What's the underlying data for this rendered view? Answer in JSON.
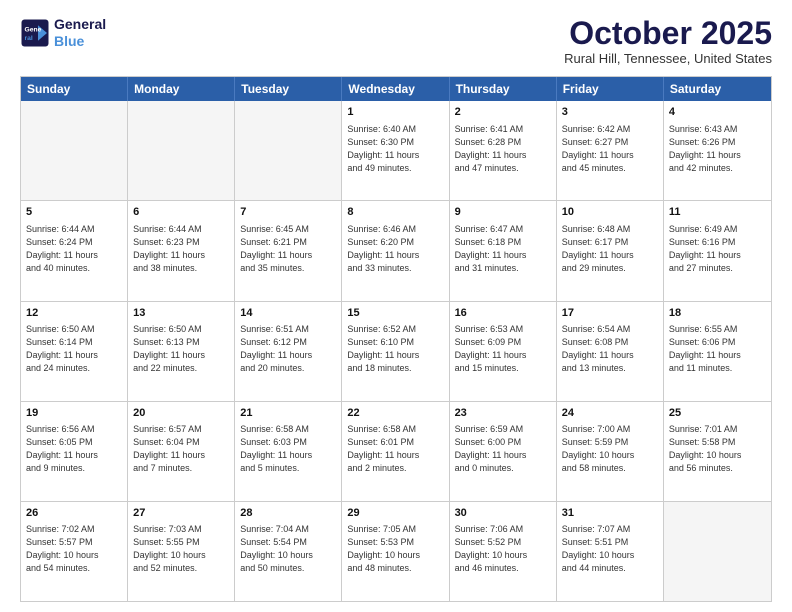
{
  "header": {
    "logo_line1": "General",
    "logo_line2": "Blue",
    "month_title": "October 2025",
    "location": "Rural Hill, Tennessee, United States"
  },
  "weekdays": [
    "Sunday",
    "Monday",
    "Tuesday",
    "Wednesday",
    "Thursday",
    "Friday",
    "Saturday"
  ],
  "rows": [
    [
      {
        "day": "",
        "text": ""
      },
      {
        "day": "",
        "text": ""
      },
      {
        "day": "",
        "text": ""
      },
      {
        "day": "1",
        "text": "Sunrise: 6:40 AM\nSunset: 6:30 PM\nDaylight: 11 hours\nand 49 minutes."
      },
      {
        "day": "2",
        "text": "Sunrise: 6:41 AM\nSunset: 6:28 PM\nDaylight: 11 hours\nand 47 minutes."
      },
      {
        "day": "3",
        "text": "Sunrise: 6:42 AM\nSunset: 6:27 PM\nDaylight: 11 hours\nand 45 minutes."
      },
      {
        "day": "4",
        "text": "Sunrise: 6:43 AM\nSunset: 6:26 PM\nDaylight: 11 hours\nand 42 minutes."
      }
    ],
    [
      {
        "day": "5",
        "text": "Sunrise: 6:44 AM\nSunset: 6:24 PM\nDaylight: 11 hours\nand 40 minutes."
      },
      {
        "day": "6",
        "text": "Sunrise: 6:44 AM\nSunset: 6:23 PM\nDaylight: 11 hours\nand 38 minutes."
      },
      {
        "day": "7",
        "text": "Sunrise: 6:45 AM\nSunset: 6:21 PM\nDaylight: 11 hours\nand 35 minutes."
      },
      {
        "day": "8",
        "text": "Sunrise: 6:46 AM\nSunset: 6:20 PM\nDaylight: 11 hours\nand 33 minutes."
      },
      {
        "day": "9",
        "text": "Sunrise: 6:47 AM\nSunset: 6:18 PM\nDaylight: 11 hours\nand 31 minutes."
      },
      {
        "day": "10",
        "text": "Sunrise: 6:48 AM\nSunset: 6:17 PM\nDaylight: 11 hours\nand 29 minutes."
      },
      {
        "day": "11",
        "text": "Sunrise: 6:49 AM\nSunset: 6:16 PM\nDaylight: 11 hours\nand 27 minutes."
      }
    ],
    [
      {
        "day": "12",
        "text": "Sunrise: 6:50 AM\nSunset: 6:14 PM\nDaylight: 11 hours\nand 24 minutes."
      },
      {
        "day": "13",
        "text": "Sunrise: 6:50 AM\nSunset: 6:13 PM\nDaylight: 11 hours\nand 22 minutes."
      },
      {
        "day": "14",
        "text": "Sunrise: 6:51 AM\nSunset: 6:12 PM\nDaylight: 11 hours\nand 20 minutes."
      },
      {
        "day": "15",
        "text": "Sunrise: 6:52 AM\nSunset: 6:10 PM\nDaylight: 11 hours\nand 18 minutes."
      },
      {
        "day": "16",
        "text": "Sunrise: 6:53 AM\nSunset: 6:09 PM\nDaylight: 11 hours\nand 15 minutes."
      },
      {
        "day": "17",
        "text": "Sunrise: 6:54 AM\nSunset: 6:08 PM\nDaylight: 11 hours\nand 13 minutes."
      },
      {
        "day": "18",
        "text": "Sunrise: 6:55 AM\nSunset: 6:06 PM\nDaylight: 11 hours\nand 11 minutes."
      }
    ],
    [
      {
        "day": "19",
        "text": "Sunrise: 6:56 AM\nSunset: 6:05 PM\nDaylight: 11 hours\nand 9 minutes."
      },
      {
        "day": "20",
        "text": "Sunrise: 6:57 AM\nSunset: 6:04 PM\nDaylight: 11 hours\nand 7 minutes."
      },
      {
        "day": "21",
        "text": "Sunrise: 6:58 AM\nSunset: 6:03 PM\nDaylight: 11 hours\nand 5 minutes."
      },
      {
        "day": "22",
        "text": "Sunrise: 6:58 AM\nSunset: 6:01 PM\nDaylight: 11 hours\nand 2 minutes."
      },
      {
        "day": "23",
        "text": "Sunrise: 6:59 AM\nSunset: 6:00 PM\nDaylight: 11 hours\nand 0 minutes."
      },
      {
        "day": "24",
        "text": "Sunrise: 7:00 AM\nSunset: 5:59 PM\nDaylight: 10 hours\nand 58 minutes."
      },
      {
        "day": "25",
        "text": "Sunrise: 7:01 AM\nSunset: 5:58 PM\nDaylight: 10 hours\nand 56 minutes."
      }
    ],
    [
      {
        "day": "26",
        "text": "Sunrise: 7:02 AM\nSunset: 5:57 PM\nDaylight: 10 hours\nand 54 minutes."
      },
      {
        "day": "27",
        "text": "Sunrise: 7:03 AM\nSunset: 5:55 PM\nDaylight: 10 hours\nand 52 minutes."
      },
      {
        "day": "28",
        "text": "Sunrise: 7:04 AM\nSunset: 5:54 PM\nDaylight: 10 hours\nand 50 minutes."
      },
      {
        "day": "29",
        "text": "Sunrise: 7:05 AM\nSunset: 5:53 PM\nDaylight: 10 hours\nand 48 minutes."
      },
      {
        "day": "30",
        "text": "Sunrise: 7:06 AM\nSunset: 5:52 PM\nDaylight: 10 hours\nand 46 minutes."
      },
      {
        "day": "31",
        "text": "Sunrise: 7:07 AM\nSunset: 5:51 PM\nDaylight: 10 hours\nand 44 minutes."
      },
      {
        "day": "",
        "text": ""
      }
    ]
  ]
}
